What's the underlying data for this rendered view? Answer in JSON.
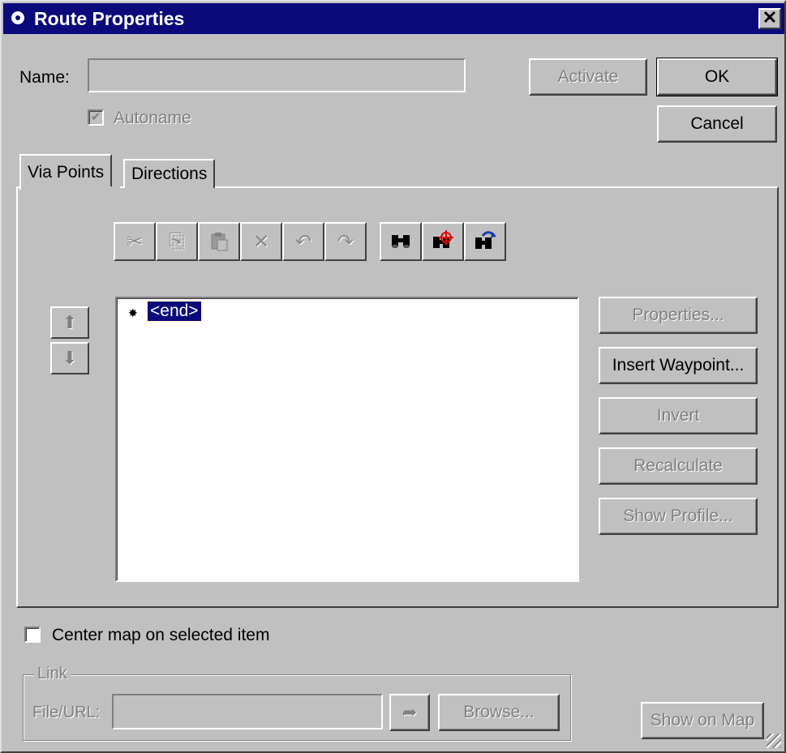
{
  "window": {
    "title": "Route Properties",
    "close_glyph": "✕"
  },
  "name_field": {
    "label": "Name:",
    "value": ""
  },
  "autoname": {
    "label": "Autoname",
    "checked": true,
    "enabled": false
  },
  "buttons": {
    "activate": "Activate",
    "ok": "OK",
    "cancel": "Cancel"
  },
  "tabs": [
    {
      "label": "Via Points",
      "active": true
    },
    {
      "label": "Directions",
      "active": false
    }
  ],
  "toolbar": {
    "cut_icon": "✂",
    "copy_icon": "⎘",
    "paste_icon": "📋",
    "delete_icon": "✕",
    "undo_icon": "↶",
    "redo_icon": "↷",
    "find_icon": "binoculars",
    "find_target_icon": "binoculars-target",
    "find_next_icon": "binoculars-arrow"
  },
  "move_buttons": {
    "up_glyph": "⬆",
    "down_glyph": "⬇"
  },
  "via_points": {
    "items": [
      {
        "marker": "✸",
        "label": "<end>",
        "selected": true
      }
    ]
  },
  "side_buttons": {
    "properties": "Properties...",
    "insert_waypoint": "Insert Waypoint...",
    "invert": "Invert",
    "recalculate": "Recalculate",
    "show_profile": "Show Profile..."
  },
  "center_map": {
    "label": "Center map on selected item",
    "checked": false
  },
  "link": {
    "legend": "Link",
    "file_url_label": "File/URL:",
    "value": "",
    "go_glyph": "➦",
    "browse": "Browse..."
  },
  "show_on_map": "Show on Map"
}
